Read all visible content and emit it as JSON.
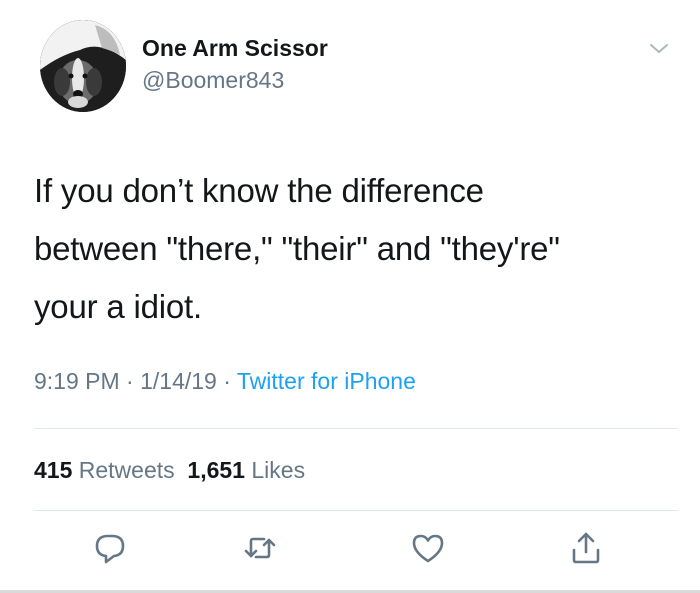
{
  "author": {
    "display_name": "One Arm Scissor",
    "handle": "@Boomer843",
    "avatar": "beagle-dog-avatar"
  },
  "tweet": {
    "lines": [
      "If you don’t know the difference",
      "between \"there,\" \"their\" and \"they're\"",
      "your a idiot."
    ]
  },
  "meta": {
    "time": "9:19 PM",
    "separator": " · ",
    "date": "1/14/19",
    "source": "Twitter for iPhone"
  },
  "stats": {
    "retweets_count": "415",
    "retweets_label": "Retweets",
    "likes_count": "1,651",
    "likes_label": "Likes"
  },
  "actions": {
    "icons": [
      "reply-icon",
      "retweet-icon",
      "like-icon",
      "share-icon"
    ],
    "icon_color": "#657786"
  },
  "colors": {
    "text": "#14171a",
    "secondary": "#657786",
    "link": "#1da1f2",
    "divider": "#e1e8ed"
  }
}
